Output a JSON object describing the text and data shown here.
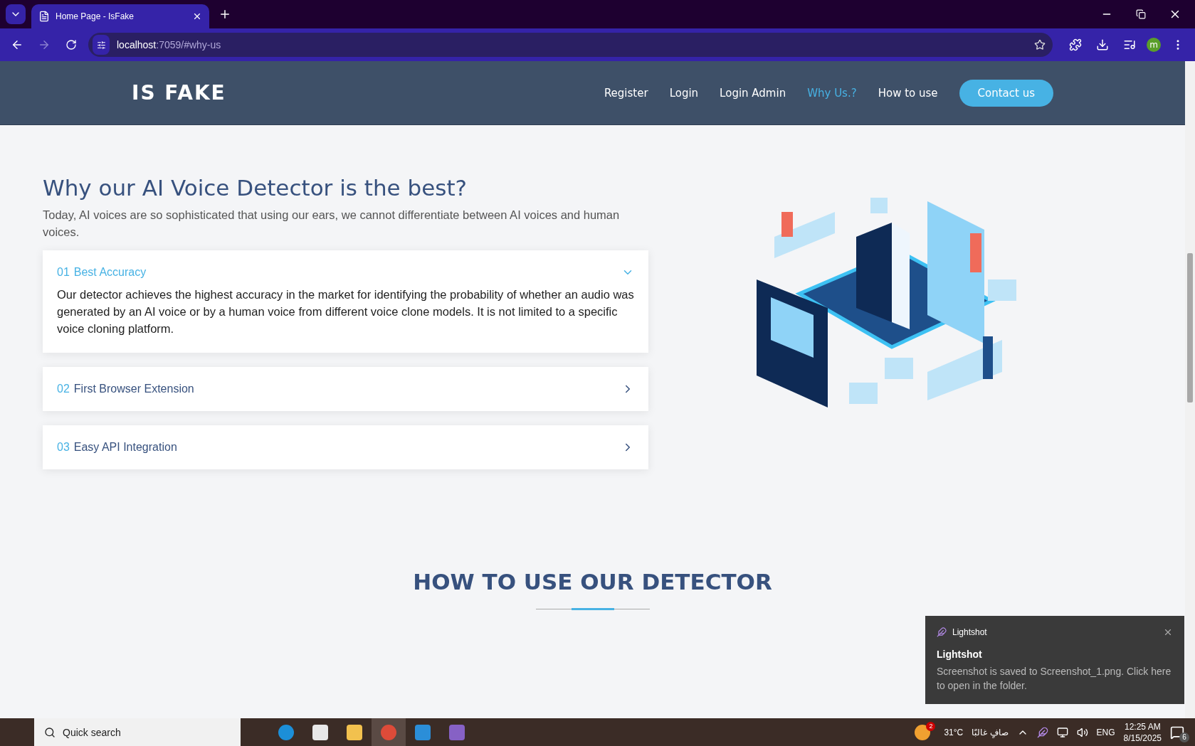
{
  "browser": {
    "tab": {
      "title": "Home Page - IsFake",
      "selected": true
    },
    "url": {
      "host": "localhost",
      "rest": ":7059/#why-us"
    },
    "profile_initial": "m"
  },
  "site": {
    "logo": "IS FAKE",
    "nav": [
      {
        "label": "Register",
        "selected": false
      },
      {
        "label": "Login",
        "selected": false
      },
      {
        "label": "Login Admin",
        "selected": false
      },
      {
        "label": "Why Us.?",
        "selected": true
      },
      {
        "label": "How to use",
        "selected": false
      }
    ],
    "contact_button": "Contact us"
  },
  "why": {
    "title": "Why our AI Voice Detector is the best?",
    "intro": "Today, AI voices are so sophisticated that using our ears, we cannot differentiate between AI voices and human voices.",
    "items": [
      {
        "number": "01",
        "title": "Best Accuracy",
        "expanded": true,
        "body": "Our detector achieves the highest accuracy in the market for identifying the probability of whether an audio was generated by an AI voice or by a human voice from different voice clone models. It is not limited to a specific voice cloning platform."
      },
      {
        "number": "02",
        "title": "First Browser Extension",
        "expanded": false
      },
      {
        "number": "03",
        "title": "Easy API Integration",
        "expanded": false
      }
    ]
  },
  "how": {
    "title": "HOW TO USE OUR DETECTOR"
  },
  "notification": {
    "app": "Lightshot",
    "title": "Lightshot",
    "message": "Screenshot is saved to Screenshot_1.png. Click here to open in the folder."
  },
  "taskbar": {
    "search": "Quick search",
    "weather_badge": "2",
    "temperature": "31°C",
    "weather_text": "صافٍ غالبًا",
    "language": "ENG",
    "time": "12:25 AM",
    "date": "8/15/2025",
    "notifications_count": "6"
  }
}
